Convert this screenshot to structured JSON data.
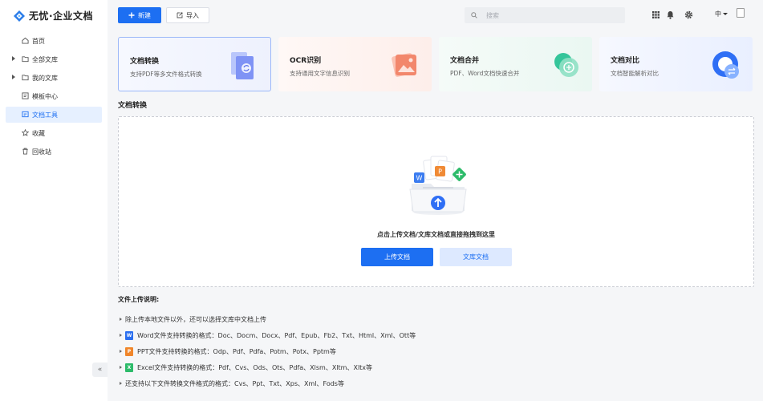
{
  "app": {
    "title": "无忧·企业文档"
  },
  "sidebar": {
    "items": [
      {
        "label": "首页",
        "icon": "home-icon"
      },
      {
        "label": "全部文库",
        "icon": "folder-icon"
      },
      {
        "label": "我的文库",
        "icon": "folder-icon"
      },
      {
        "label": "模板中心",
        "icon": "template-icon"
      },
      {
        "label": "文档工具",
        "icon": "tools-icon",
        "active": true
      },
      {
        "label": "收藏",
        "icon": "star-icon"
      },
      {
        "label": "回收站",
        "icon": "trash-icon"
      }
    ],
    "collapse_label": "«"
  },
  "toolbar": {
    "new_label": "新建",
    "import_label": "导入",
    "search_placeholder": "搜索",
    "lang_label": "中"
  },
  "tools": [
    {
      "title": "文档转换",
      "desc": "支持PDF等多文件格式转换",
      "icon": "document-convert-icon"
    },
    {
      "title": "OCR识别",
      "desc": "支持通用文字信息识别",
      "icon": "image-ocr-icon"
    },
    {
      "title": "文档合并",
      "desc": "PDF、Word文档快速合并",
      "icon": "merge-icon"
    },
    {
      "title": "文档对比",
      "desc": "文档智能解析对比",
      "icon": "compare-icon"
    }
  ],
  "section": {
    "title": "文档转换"
  },
  "upload": {
    "hint": "点击上传文档/文库文档或直接拖拽到这里",
    "upload_label": "上传文档",
    "library_label": "文库文档"
  },
  "instructions": {
    "title": "文件上传说明:",
    "rows": [
      {
        "text": "除上传本地文件以外，还可以选择文库中文档上传",
        "icon": ""
      },
      {
        "text": "Word文件支持转换的格式：Doc、Docm、Docx、Pdf、Epub、Fb2、Txt、Html、Xml、Ott等",
        "icon": "word-icon"
      },
      {
        "text": "PPT文件支持转换的格式：Odp、Pdf、Pdfa、Potm、Potx、Pptm等",
        "icon": "ppt-icon"
      },
      {
        "text": "Excel文件支持转换的格式：Pdf、Cvs、Ods、Ots、Pdfa、Xlsm、Xltm、Xltx等",
        "icon": "excel-icon"
      },
      {
        "text": "还支持以下文件转换文件格式的格式：Cvs、Ppt、Txt、Xps、Xml、Fods等",
        "icon": ""
      }
    ]
  },
  "colors": {
    "accent": "#1d6ff2",
    "word": "#2b6ff0",
    "ppt": "#f0862b",
    "excel": "#2dbb6a"
  }
}
